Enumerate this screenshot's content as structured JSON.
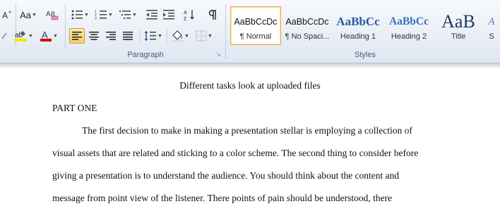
{
  "ribbon": {
    "font_size_grow_label": "A",
    "change_case_label": "Aa",
    "groups": {
      "paragraph_label": "Paragraph",
      "styles_label": "Styles"
    },
    "styles": [
      {
        "sample": "AaBbCcDc",
        "name": "¶ Normal"
      },
      {
        "sample": "AaBbCcDc",
        "name": "¶ No Spaci..."
      },
      {
        "sample": "AaBbCc",
        "name": "Heading 1"
      },
      {
        "sample": "AaBbCc",
        "name": "Heading 2"
      },
      {
        "sample": "AaB",
        "name": "Title"
      },
      {
        "sample": "A",
        "name": "S"
      }
    ],
    "colors": {
      "highlight": "#f2e600",
      "font_color": "#d00000",
      "heading_blue": "#2a5aa0"
    }
  },
  "document": {
    "title": "Different tasks look at uploaded files",
    "section_heading": "PART ONE",
    "lines": [
      "The first decision to make in making a presentation stellar is employing a collection of",
      "visual assets that are related and sticking to a color scheme. The second thing to consider before",
      "giving a presentation is to understand the audience. You should think about the content and",
      "message  from point view of the listener. There  points of pain should be understood, there"
    ]
  }
}
